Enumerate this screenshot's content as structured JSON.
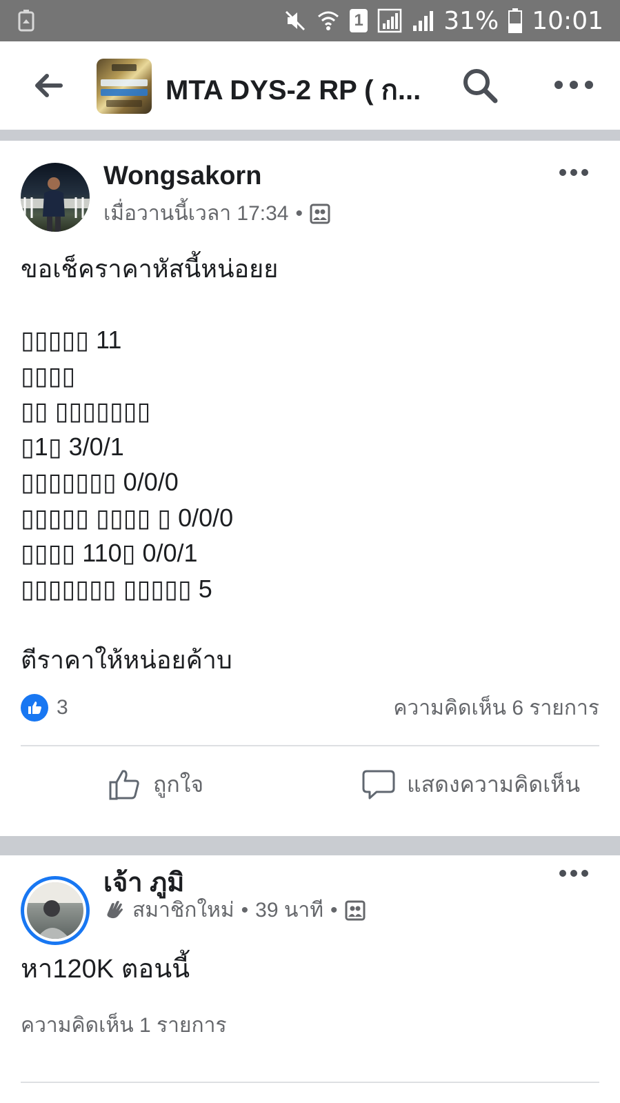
{
  "status_bar": {
    "battery_percent": "31%",
    "time": "10:01",
    "sim_slot": "1"
  },
  "app_bar": {
    "group_title": "MTA DYS-2 RP ( ก...",
    "icons": [
      "back-arrow-icon",
      "search-icon",
      "more-icon"
    ]
  },
  "posts": [
    {
      "author": "Wongsakorn",
      "timestamp": "เมื่อวานนี้เวลา 17:34",
      "body": "ขอเช็คราคาหัสนี้หน่อยย\n\n▯▯▯▯▯ 11\n▯▯▯▯\n▯▯ ▯▯▯▯▯▯▯\n▯1▯ 3/0/1\n▯▯▯▯▯▯▯ 0/0/0\n▯▯▯▯▯ ▯▯▯▯ ▯ 0/0/0\n▯▯▯▯ 110▯ 0/0/1\n▯▯▯▯▯▯▯ ▯▯▯▯▯ 5\n\nตีราคาให้หน่อยค้าบ",
      "like_count": "3",
      "comment_count": "ความคิดเห็น 6 รายการ",
      "like_label": "ถูกใจ",
      "comment_label": "แสดงความคิดเห็น"
    },
    {
      "author": "เจ้า ภูมิ",
      "badge": "สมาชิกใหม่",
      "timestamp": "39 นาที",
      "body": "หา120K ตอนนี้",
      "comment_count": "ความคิดเห็น 1 รายการ"
    }
  ],
  "colors": {
    "status_bar": "#757575",
    "divider": "#c9ccd1",
    "brand_blue": "#1877f2",
    "secondary_text": "#65676b"
  }
}
